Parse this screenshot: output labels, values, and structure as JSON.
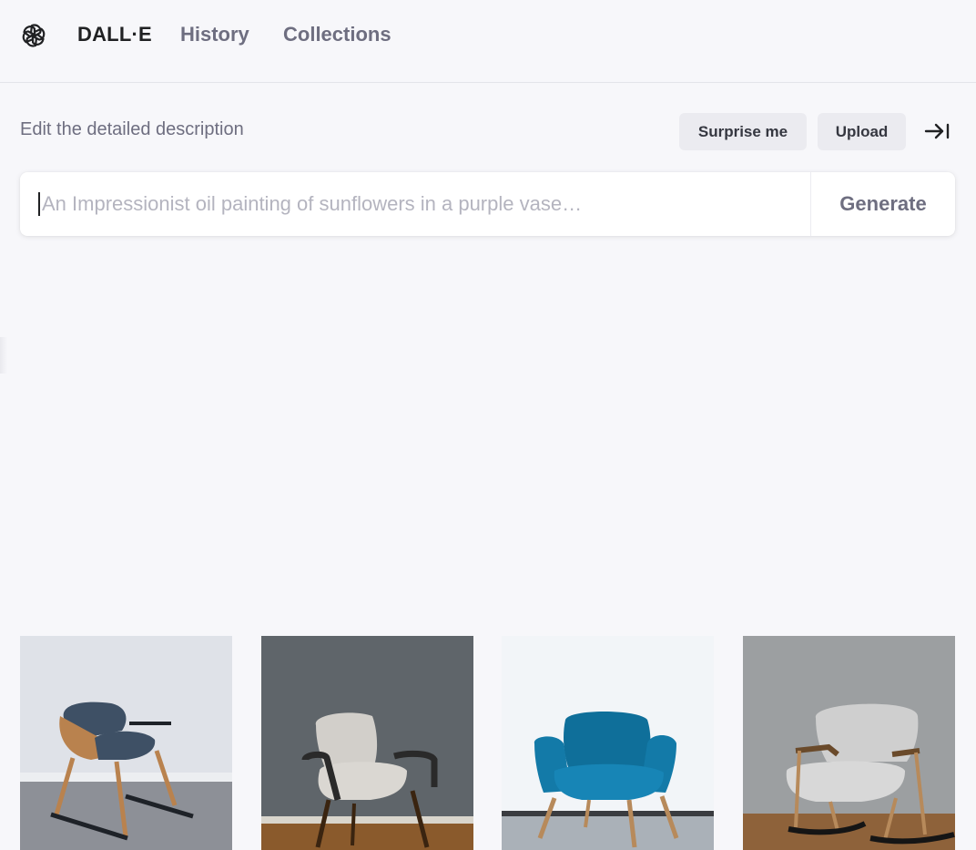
{
  "header": {
    "logo_icon": "openai-logo-icon",
    "brand": "DALL·E",
    "nav": [
      {
        "label": "History"
      },
      {
        "label": "Collections"
      }
    ]
  },
  "editor": {
    "description_label": "Edit the detailed description",
    "surprise_label": "Surprise me",
    "upload_label": "Upload",
    "collapse_icon": "arrow-right-to-bar-icon",
    "prompt_value": "",
    "prompt_placeholder": "An Impressionist oil painting of sunflowers in a purple vase…",
    "generate_label": "Generate"
  },
  "gallery": {
    "images": [
      {
        "subject": "wooden rocking chair with dark blue seat",
        "seat_color": "#3e5065",
        "wall_color": "#dfe2e8"
      },
      {
        "subject": "light grey wingback chair with dark wooden arms",
        "seat_color": "#d2cfca",
        "wall_color": "#5f656a"
      },
      {
        "subject": "teal blue armchair with wooden legs",
        "seat_color": "#0f6f9a",
        "wall_color": "#f2f5f8"
      },
      {
        "subject": "grey upholstered rocking chair",
        "seat_color": "#cfcfcf",
        "wall_color": "#9c9fa1"
      }
    ]
  }
}
